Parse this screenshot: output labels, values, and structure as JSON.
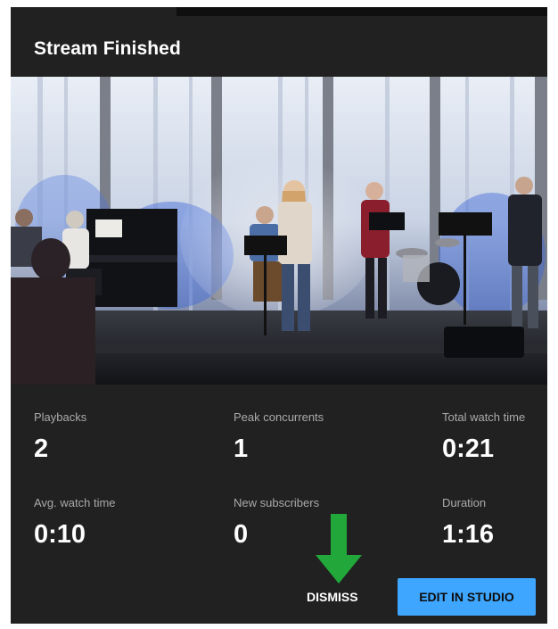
{
  "dialog": {
    "title": "Stream Finished"
  },
  "stats": [
    {
      "label": "Playbacks",
      "value": "2"
    },
    {
      "label": "Peak concurrents",
      "value": "1"
    },
    {
      "label": "Total watch time",
      "value": "0:21"
    },
    {
      "label": "Avg. watch time",
      "value": "0:10"
    },
    {
      "label": "New subscribers",
      "value": "0"
    },
    {
      "label": "Duration",
      "value": "1:16"
    }
  ],
  "actions": {
    "dismiss_label": "DISMISS",
    "edit_label": "EDIT IN STUDIO"
  },
  "colors": {
    "dialog_bg": "#212121",
    "primary_button": "#3ea6ff",
    "annotation_arrow": "#22a83a"
  },
  "icons": {
    "annotation": "down-arrow-icon"
  }
}
